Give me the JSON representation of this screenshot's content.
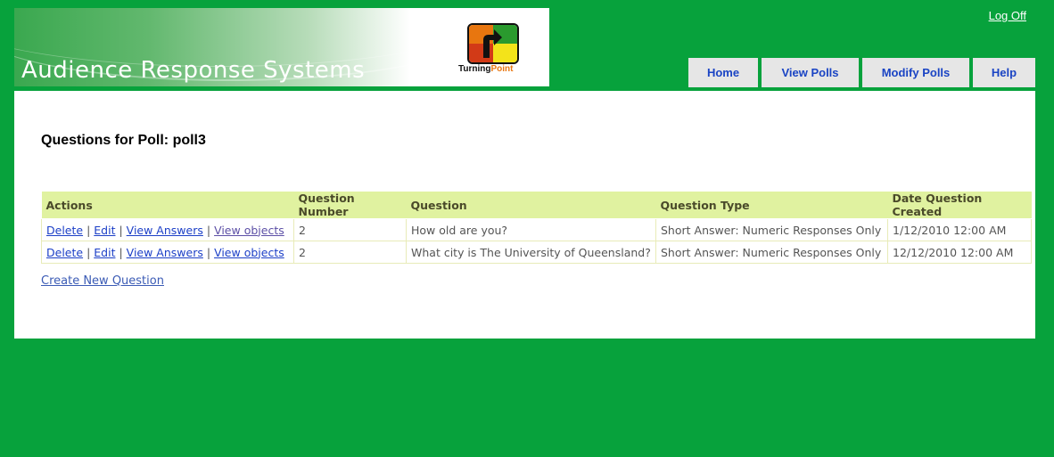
{
  "header": {
    "banner_title": "Audience Response Systems",
    "logo_text_a": "Turning",
    "logo_text_b": "Point",
    "logoff_label": "Log Off"
  },
  "nav": {
    "tabs": [
      {
        "label": "Home"
      },
      {
        "label": "View Polls"
      },
      {
        "label": "Modify Polls"
      },
      {
        "label": "Help"
      }
    ]
  },
  "main": {
    "title": "Questions for Poll: poll3",
    "table": {
      "headers": [
        "Actions",
        "Question Number",
        "Question",
        "Question Type",
        "Date Question Created"
      ],
      "action_labels": {
        "delete": "Delete",
        "edit": "Edit",
        "view_answers": "View Answers",
        "view_objects": "View objects",
        "separator": "|"
      },
      "rows": [
        {
          "number": "2",
          "question": "How old are you?",
          "type": "Short Answer: Numeric Responses Only",
          "date": "1/12/2010 12:00 AM"
        },
        {
          "number": "2",
          "question": "What city is The University of Queensland?",
          "type": "Short Answer: Numeric Responses Only",
          "date": "12/12/2010 12:00 AM"
        }
      ]
    },
    "create_link": "Create New Question"
  },
  "colors": {
    "page_background": "#07a23c",
    "table_header": "#e0f2a0",
    "link": "#1c3fc7",
    "tab_text": "#1a44c4"
  }
}
